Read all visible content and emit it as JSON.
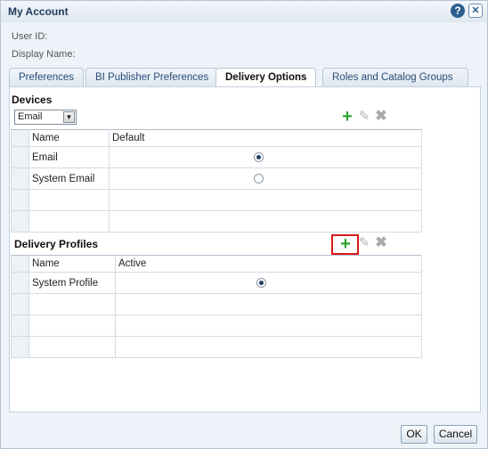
{
  "dialog": {
    "title": "My Account"
  },
  "fields": {
    "user_id_label": "User ID:",
    "display_name_label": "Display Name:"
  },
  "tabs": [
    {
      "label": "Preferences"
    },
    {
      "label": "BI Publisher Preferences"
    },
    {
      "label": "Delivery Options",
      "active": true
    },
    {
      "label": "Roles and Catalog Groups"
    }
  ],
  "devices": {
    "title": "Devices",
    "select_value": "Email",
    "columns": [
      "Name",
      "Default"
    ],
    "rows": [
      {
        "name": "Email",
        "default": true
      },
      {
        "name": "System Email",
        "default": false
      }
    ]
  },
  "profiles": {
    "title": "Delivery Profiles",
    "columns": [
      "Name",
      "Active"
    ],
    "rows": [
      {
        "name": "System Profile",
        "active": true
      }
    ]
  },
  "buttons": {
    "ok": "OK",
    "cancel": "Cancel"
  },
  "icons": {
    "help": "?",
    "close": "✕",
    "plus": "+",
    "pencil": "✎",
    "delete": "✖"
  },
  "colors": {
    "accent": "#2c5e8f",
    "add_green": "#2ea42e",
    "highlight_red": "#d61a1a"
  }
}
